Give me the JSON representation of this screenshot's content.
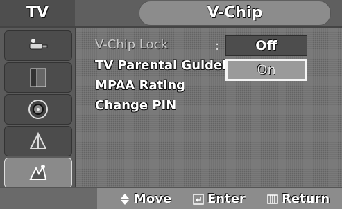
{
  "header": {
    "section": "TV",
    "title": "V-Chip"
  },
  "sidebar": {
    "icons": [
      "input-icon",
      "picture-icon",
      "sound-icon",
      "channel-icon",
      "setup-icon"
    ]
  },
  "menu": {
    "items": [
      {
        "label": "V-Chip Lock",
        "dim": true
      },
      {
        "label": "TV Parental Guideli"
      },
      {
        "label": "MPAA Rating"
      },
      {
        "label": "Change PIN"
      }
    ],
    "separator": ":"
  },
  "options": {
    "off": "Off",
    "on": "On"
  },
  "footer": {
    "move": "Move",
    "enter": "Enter",
    "return": "Return"
  }
}
